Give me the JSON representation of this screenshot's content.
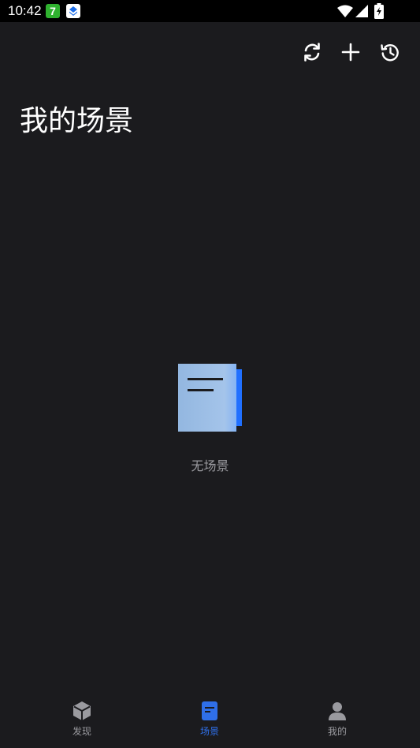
{
  "status_bar": {
    "time": "10:42",
    "notification_icons": [
      "seven-app-icon",
      "stack-app-icon"
    ],
    "notification_badge_text": "7",
    "system_icons": [
      "wifi-icon",
      "signal-icon",
      "battery-charging-icon"
    ]
  },
  "toolbar": {
    "actions": [
      {
        "name": "sync",
        "icon": "refresh-icon"
      },
      {
        "name": "add",
        "icon": "plus-icon"
      },
      {
        "name": "history",
        "icon": "history-icon"
      }
    ]
  },
  "page": {
    "title": "我的场景"
  },
  "empty_state": {
    "icon": "document-icon",
    "label": "无场景"
  },
  "bottom_nav": {
    "items": [
      {
        "label": "发现",
        "icon": "cube-icon",
        "active": false
      },
      {
        "label": "场景",
        "icon": "scene-doc-icon",
        "active": true
      },
      {
        "label": "我的",
        "icon": "person-icon",
        "active": false
      }
    ]
  },
  "colors": {
    "background": "#1b1b1e",
    "status_bar": "#000000",
    "accent": "#2f6fe8",
    "muted_text": "#9a9a9f",
    "illustration_light": "#9dbde4",
    "illustration_dark": "#2070ff"
  }
}
